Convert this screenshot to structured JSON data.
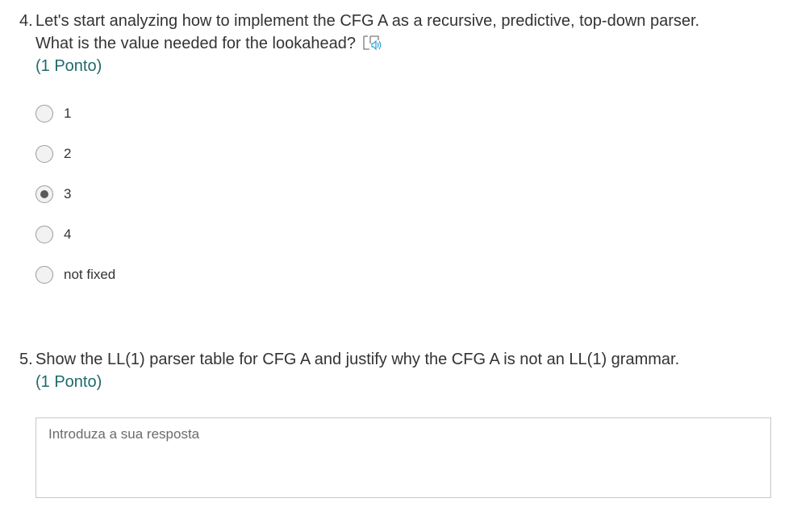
{
  "questions": {
    "q4": {
      "number": "4.",
      "text_line1": "Let's start analyzing how to implement the CFG A as a recursive, predictive, top-down parser.",
      "text_line2": "What is the value needed for the lookahead?",
      "points": "(1 Ponto)",
      "reader_icon": "immersive-reader-icon",
      "selected_index": 2,
      "options": [
        {
          "label": "1"
        },
        {
          "label": "2"
        },
        {
          "label": "3"
        },
        {
          "label": "4"
        },
        {
          "label": "not fixed"
        }
      ]
    },
    "q5": {
      "number": "5.",
      "text_line1": "Show the LL(1) parser table for CFG A and justify why the CFG A is not an LL(1) grammar.",
      "points": "(1 Ponto)",
      "answer_placeholder": "Introduza a sua resposta",
      "answer_value": ""
    }
  },
  "colors": {
    "text": "#333333",
    "points": "#1f6a6d",
    "reader_icon_accent": "#2aa0d8",
    "radio_border": "#9b9b9b",
    "radio_dot": "#5a5a5a"
  }
}
